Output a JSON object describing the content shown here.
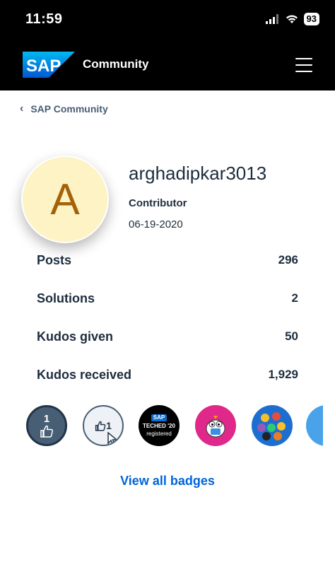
{
  "status_bar": {
    "time": "11:59",
    "battery": "93"
  },
  "header": {
    "logo_text": "SAP",
    "title": "Community",
    "brand_color": "#0a6ed1"
  },
  "breadcrumb": {
    "label": "SAP Community"
  },
  "profile": {
    "avatar_initial": "A",
    "username": "arghadipkar3013",
    "rank": "Contributor",
    "join_date": "06-19-2020"
  },
  "stats": [
    {
      "label": "Posts",
      "value": "296"
    },
    {
      "label": "Solutions",
      "value": "2"
    },
    {
      "label": "Kudos given",
      "value": "50"
    },
    {
      "label": "Kudos received",
      "value": "1,929"
    }
  ],
  "badges": [
    {
      "name": "kudos-1-badge",
      "count": "1"
    },
    {
      "name": "kudos-given-1-badge",
      "count": "1"
    },
    {
      "name": "teched-2020-badge",
      "logo": "SAP",
      "title": "TECHED '20",
      "subtitle": "registered"
    },
    {
      "name": "pink-bird-badge"
    },
    {
      "name": "blue-birds-badge"
    },
    {
      "name": "partial-badge"
    }
  ],
  "view_all_label": "View all badges"
}
